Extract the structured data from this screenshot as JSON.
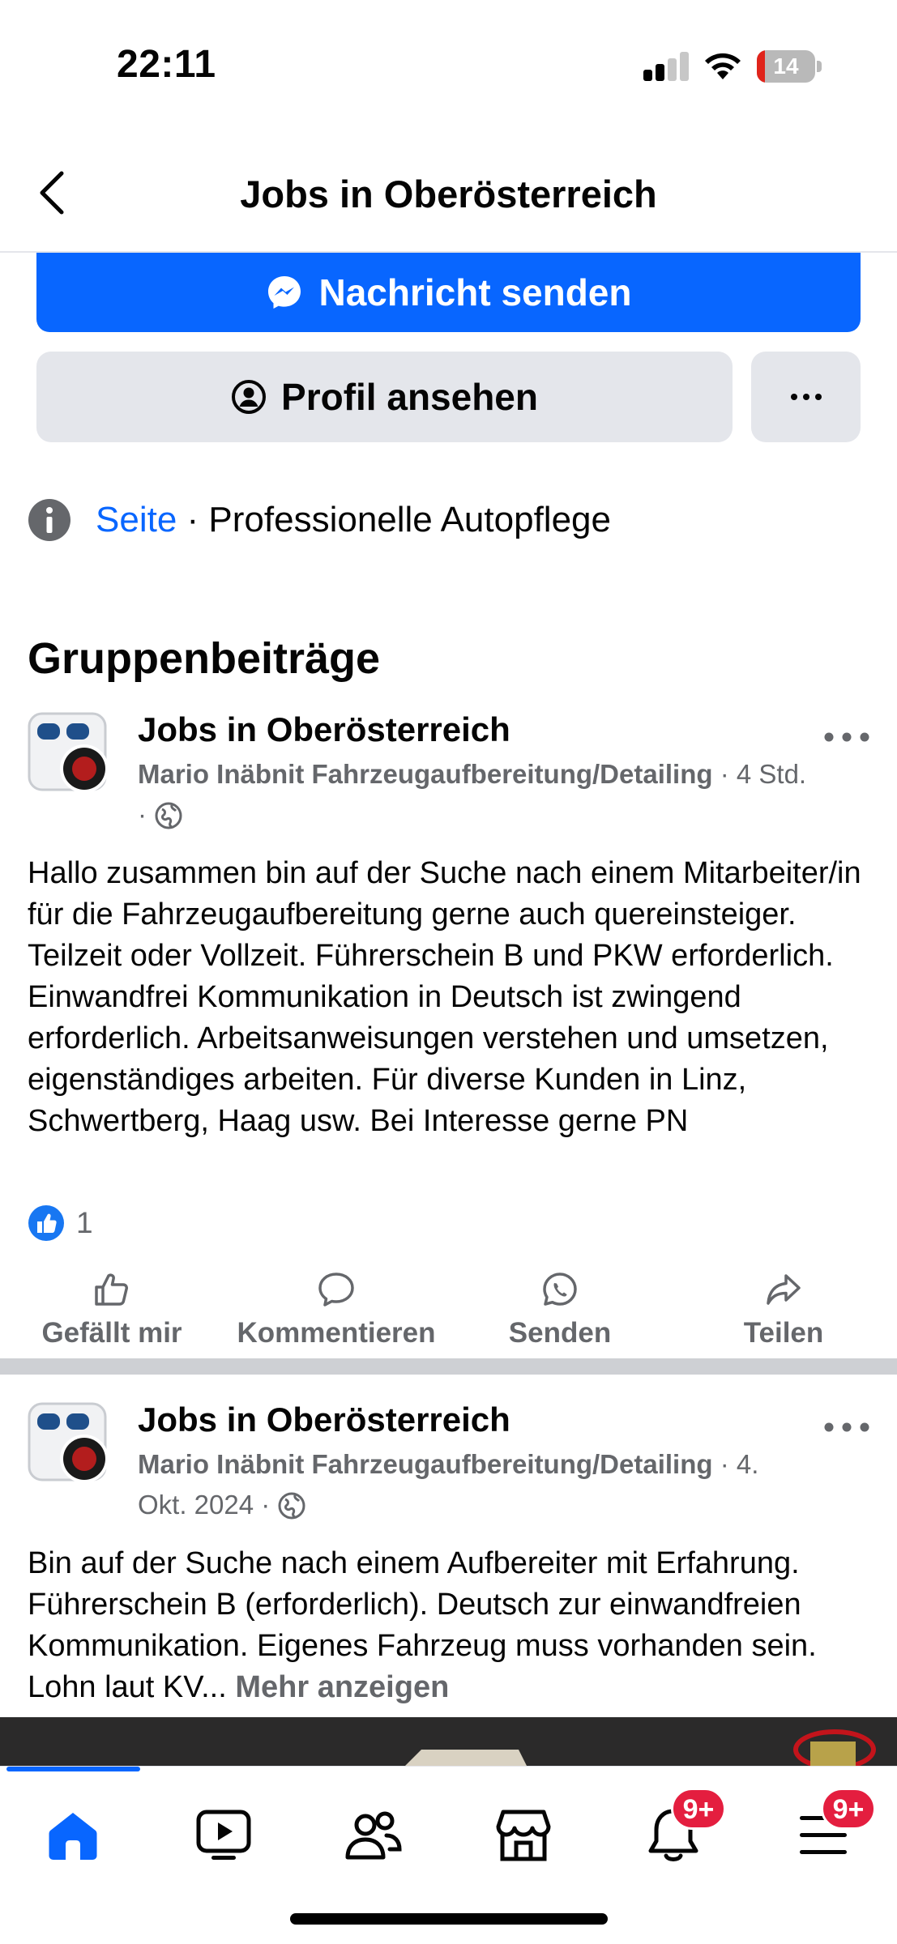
{
  "status_bar": {
    "time": "22:11",
    "battery": {
      "level": "14",
      "fraction": 0.14,
      "color": "#e0241b"
    },
    "signal_bars_active": 2,
    "icons": [
      "signal-icon",
      "wifi-icon",
      "battery-icon"
    ]
  },
  "header": {
    "title": "Jobs in Oberösterreich",
    "back_icon": "chevron-left-icon"
  },
  "profile_actions": {
    "message_label": "Nachricht senden",
    "message_icon": "messenger-icon",
    "profile_label": "Profil ansehen",
    "profile_icon": "person-circle-icon",
    "more_icon": "more-horizontal-icon"
  },
  "info": {
    "icon": "info-icon",
    "link": "Seite",
    "separator": " · ",
    "category": "Professionelle Autopflege"
  },
  "section_title": "Gruppenbeiträge",
  "posts": [
    {
      "group": "Jobs in Oberösterreich",
      "author": "Mario Inäbnit Fahrzeugaufbereitung/Detailing",
      "meta_sep": " · ",
      "time": "4 Std.",
      "visibility_icon": "globe-icon",
      "text": "Hallo zusammen bin auf der Suche nach einem Mitarbeiter/in für die Fahrzeugaufbereitung gerne auch quereinsteiger. Teilzeit oder Vollzeit. Führerschein B und PKW erforderlich. Einwandfrei Kommunikation in Deutsch ist zwingend erforderlich. Arbeitsanweisungen verstehen und umsetzen, eigenständiges arbeiten. Für diverse Kunden in Linz, Schwertberg, Haag usw. Bei Interesse gerne PN",
      "likes": "1"
    },
    {
      "group": "Jobs in Oberösterreich",
      "author": "Mario Inäbnit Fahrzeugaufbereitung/Detailing",
      "meta_sep": " · ",
      "time": "4. Okt. 2024",
      "visibility_icon": "globe-icon",
      "text": "Bin auf der Suche nach einem Aufbereiter mit Erfahrung. Führerschein B (erforderlich). Deutsch zur einwandfreien Kommunikation. Eigenes Fahrzeug muss vorhanden sein. Lohn laut KV...",
      "more": "Mehr anzeigen"
    }
  ],
  "post_actions": {
    "like": "Gefällt mir",
    "comment": "Kommentieren",
    "send": "Senden",
    "share": "Teilen"
  },
  "tabbar": {
    "tabs": [
      "home-icon",
      "video-icon",
      "friends-icon",
      "marketplace-icon",
      "notifications-icon",
      "menu-icon"
    ],
    "active": "home-icon",
    "notifications_badge": "9+",
    "menu_badge": "9+"
  },
  "colors": {
    "accent": "#0866ff",
    "secondary_text": "#65676b",
    "badge": "#e41e3f"
  }
}
